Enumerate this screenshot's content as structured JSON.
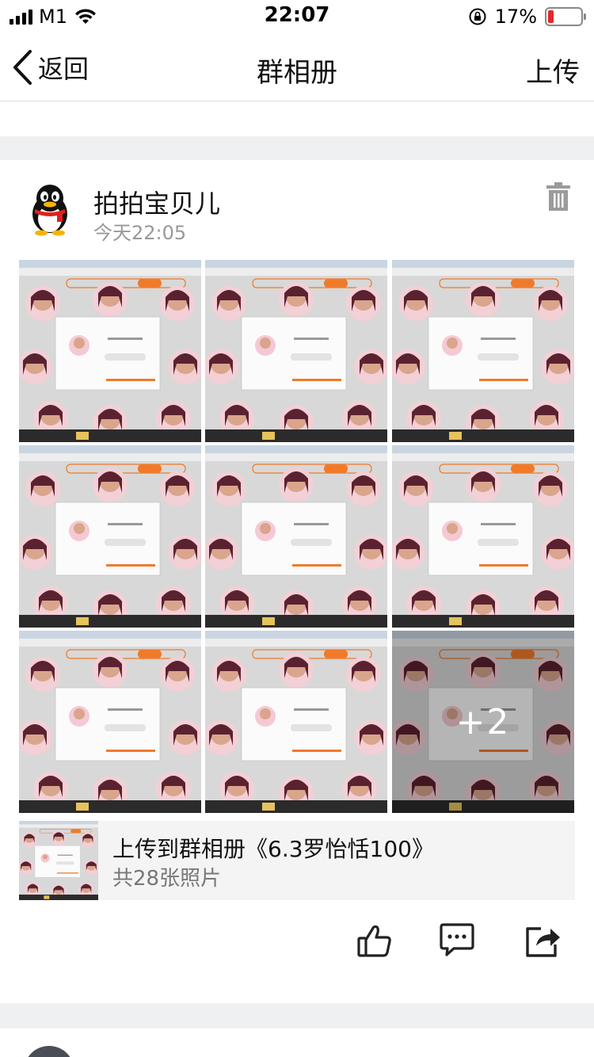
{
  "status_bar": {
    "carrier": "M1",
    "time": "22:07",
    "battery_percent": "17%",
    "battery_level": 0.17
  },
  "nav": {
    "back_label": "返回",
    "title": "群相册",
    "upload_label": "上传"
  },
  "post": {
    "author": "拍拍宝贝儿",
    "time": "今天22:05",
    "more_count": "+2",
    "album_title": "上传到群相册《6.3罗怡恬100》",
    "album_count": "共28张照片"
  },
  "icons": {
    "back": "chevron-left-icon",
    "trash": "trash-icon",
    "like": "thumbs-up-icon",
    "comment": "comment-icon",
    "share": "share-icon",
    "avatar": "qq-penguin-icon"
  },
  "colors": {
    "accent_orange": "#f07a2a",
    "battery_red": "#e8262b",
    "separator": "#eff0f2"
  }
}
